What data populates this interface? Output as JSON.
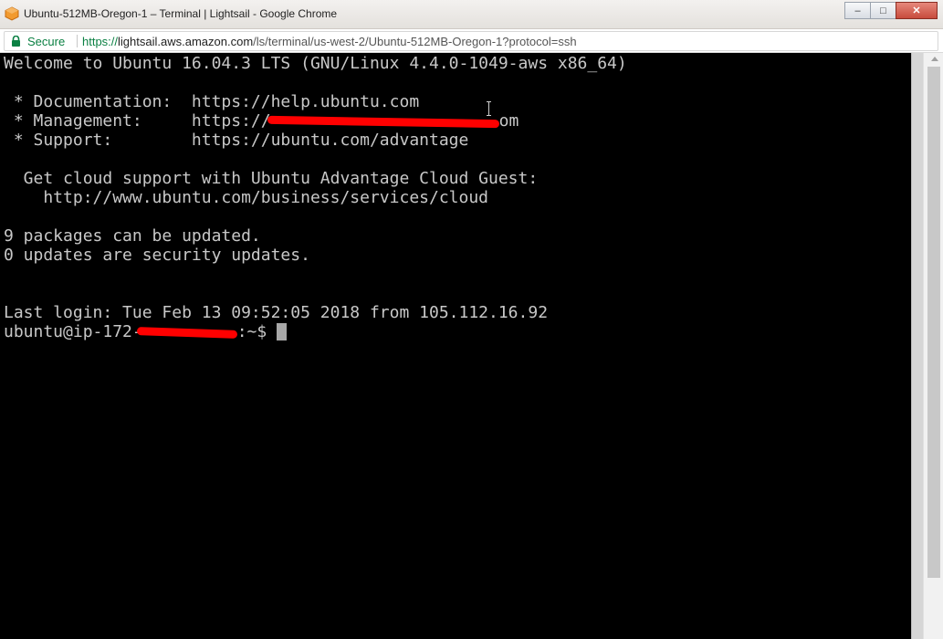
{
  "window": {
    "title": "Ubuntu-512MB-Oregon-1 – Terminal | Lightsail - Google Chrome",
    "controls": {
      "minimize": "–",
      "maximize": "□",
      "close": "✕"
    }
  },
  "addressbar": {
    "secure_label": "Secure",
    "url_scheme": "https://",
    "url_host": "lightsail.aws.amazon.com",
    "url_path": "/ls/terminal/us-west-2/Ubuntu-512MB-Oregon-1?protocol=ssh"
  },
  "terminal": {
    "welcome": "Welcome to Ubuntu 16.04.3 LTS (GNU/Linux 4.4.0-1049-aws x86_64)",
    "doc_line": " * Documentation:  https://help.ubuntu.com",
    "mgmt_prefix": " * Management:     https://",
    "mgmt_suffix": "om",
    "support_line": " * Support:        https://ubuntu.com/advantage",
    "cloud_line": "  Get cloud support with Ubuntu Advantage Cloud Guest:",
    "cloud_url": "    http://www.ubuntu.com/business/services/cloud",
    "packages_line": "9 packages can be updated.",
    "security_line": "0 updates are security updates.",
    "last_login": "Last login: Tue Feb 13 09:52:05 2018 from 105.112.16.92",
    "prompt_prefix": "ubuntu@ip-172-",
    "prompt_suffix": ":~$"
  },
  "colors": {
    "terminal_bg": "#000000",
    "terminal_fg": "#c8c8c8",
    "redaction": "#ff0000",
    "secure_green": "#0b8043"
  }
}
